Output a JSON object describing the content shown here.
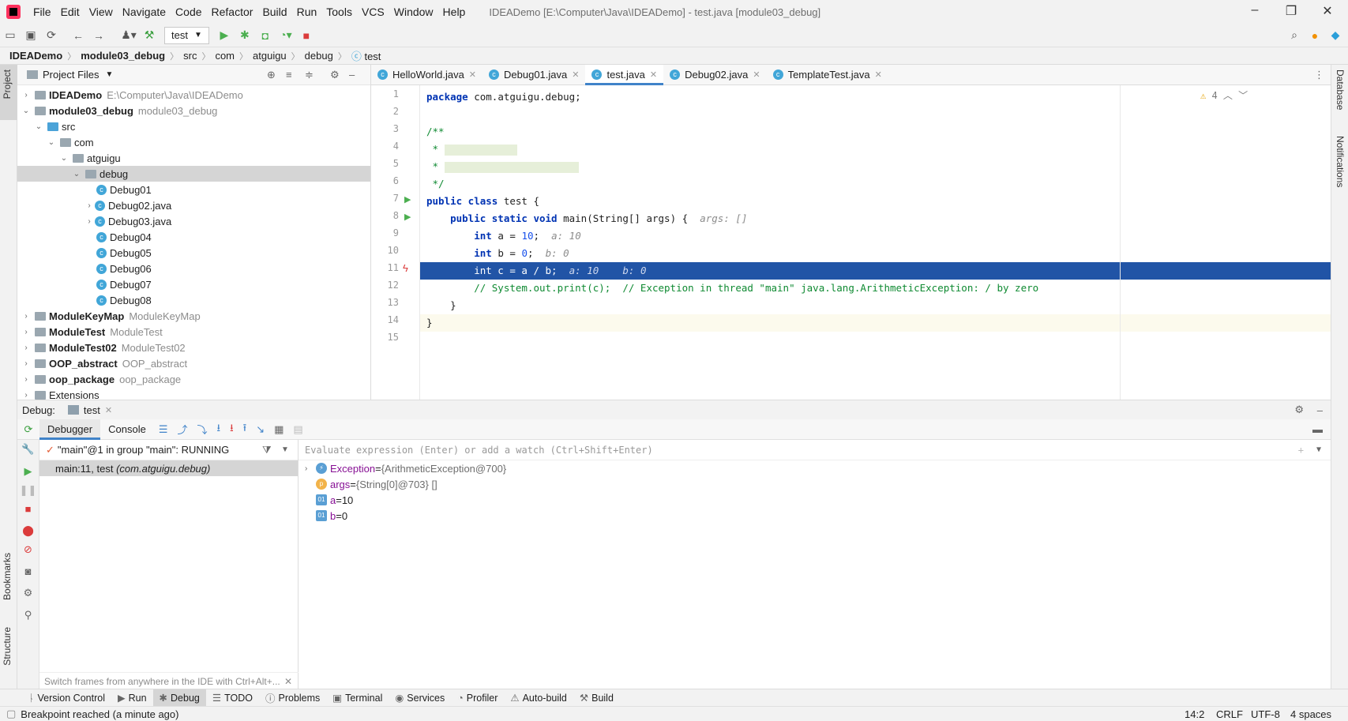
{
  "window": {
    "title": "IDEADemo [E:\\Computer\\Java\\IDEADemo] - test.java [module03_debug]",
    "menu": [
      "File",
      "Edit",
      "View",
      "Navigate",
      "Code",
      "Refactor",
      "Build",
      "Run",
      "Tools",
      "VCS",
      "Window",
      "Help"
    ]
  },
  "toolbar": {
    "run_config": "test"
  },
  "breadcrumb": [
    "IDEADemo",
    "module03_debug",
    "src",
    "com",
    "atguigu",
    "debug",
    "test"
  ],
  "left_strip": {
    "project": "Project",
    "bookmarks": "Bookmarks",
    "structure": "Structure"
  },
  "right_strip": {
    "database": "Database",
    "notifications": "Notifications"
  },
  "project": {
    "header": "Project Files",
    "rows": [
      {
        "name": "IDEADemo",
        "hint": "E:\\Computer\\Java\\IDEADemo"
      },
      {
        "name": "module03_debug",
        "hint": "module03_debug"
      },
      {
        "name": "src",
        "hint": ""
      },
      {
        "name": "com",
        "hint": ""
      },
      {
        "name": "atguigu",
        "hint": ""
      },
      {
        "name": "debug",
        "hint": ""
      },
      {
        "name": "Debug01",
        "hint": ""
      },
      {
        "name": "Debug02.java",
        "hint": ""
      },
      {
        "name": "Debug03.java",
        "hint": ""
      },
      {
        "name": "Debug04",
        "hint": ""
      },
      {
        "name": "Debug05",
        "hint": ""
      },
      {
        "name": "Debug06",
        "hint": ""
      },
      {
        "name": "Debug07",
        "hint": ""
      },
      {
        "name": "Debug08",
        "hint": ""
      },
      {
        "name": "ModuleKeyMap",
        "hint": "ModuleKeyMap"
      },
      {
        "name": "ModuleTest",
        "hint": "ModuleTest"
      },
      {
        "name": "ModuleTest02",
        "hint": "ModuleTest02"
      },
      {
        "name": "OOP_abstract",
        "hint": "OOP_abstract"
      },
      {
        "name": "oop_package",
        "hint": "oop_package"
      },
      {
        "name": "Extensions",
        "hint": ""
      }
    ]
  },
  "editor": {
    "tabs": [
      "HelloWorld.java",
      "Debug01.java",
      "test.java",
      "Debug02.java",
      "TemplateTest.java"
    ],
    "warnings": "4",
    "lines": [
      "1",
      "2",
      "3",
      "4",
      "5",
      "6",
      "7",
      "8",
      "9",
      "10",
      "11",
      "12",
      "13",
      "14",
      "15"
    ],
    "code": {
      "l1_kw": "package",
      "l1_rest": " com.atguigu.debug;",
      "l3": "/**",
      "l4": " *",
      "l5": " *",
      "l6": " */",
      "l7_kw": "public class",
      "l7_rest": " test {",
      "l8_kw": "    public static void",
      "l8_rest": " main(String[] args) {",
      "l8_hint": "args: []",
      "l9_kw": "        int",
      "l9_a": " a = ",
      "l9_num": "10",
      "l9_end": ";",
      "l9_hint": "a: 10",
      "l10_kw": "        int",
      "l10_a": " b = ",
      "l10_num": "0",
      "l10_end": ";",
      "l10_hint": "b: 0",
      "l11": "        int c = a / b;",
      "l11_hint": "a: 10    b: 0",
      "l12": "        // System.out.print(c);  // Exception in thread \"main\" java.lang.ArithmeticException: / by zero",
      "l13": "    }",
      "l14": "}"
    }
  },
  "debug": {
    "label": "Debug:",
    "session": "test",
    "tab_debugger": "Debugger",
    "tab_console": "Console",
    "thread": "\"main\"@1 in group \"main\": RUNNING",
    "frame": "main:11, test",
    "frame_pkg": "(com.atguigu.debug)",
    "eval_placeholder": "Evaluate expression (Enter) or add a watch (Ctrl+Shift+Enter)",
    "frames_hint": "Switch frames from anywhere in the IDE with Ctrl+Alt+...",
    "vars": [
      {
        "name": "Exception",
        "eq": " = ",
        "value": "{ArithmeticException@700}"
      },
      {
        "name": "args",
        "eq": " = ",
        "value": "{String[0]@703} []"
      },
      {
        "name": "a",
        "eq": " = ",
        "value": "10"
      },
      {
        "name": "b",
        "eq": " = ",
        "value": "0"
      }
    ]
  },
  "bottom_tabs": [
    "Version Control",
    "Run",
    "Debug",
    "TODO",
    "Problems",
    "Terminal",
    "Services",
    "Profiler",
    "Auto-build",
    "Build"
  ],
  "status": {
    "message": "Breakpoint reached (a minute ago)",
    "position": "14:2",
    "line_sep": "CRLF",
    "encoding": "UTF-8",
    "indent": "4 spaces"
  }
}
